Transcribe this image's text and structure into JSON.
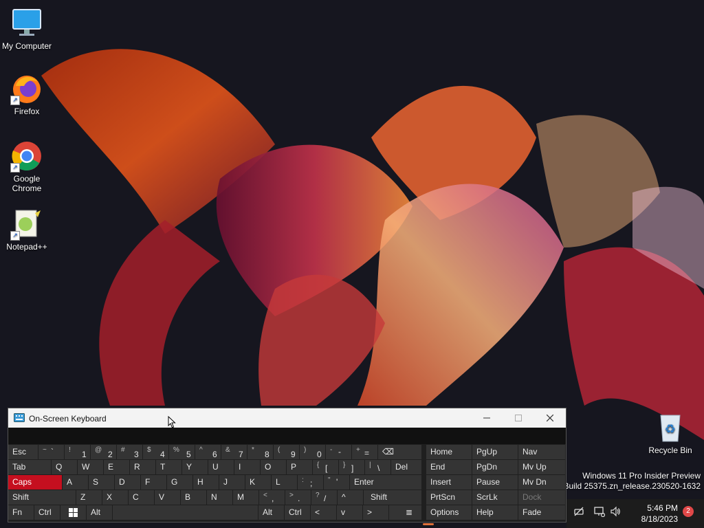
{
  "desktop": {
    "icons": [
      {
        "label": "My Computer",
        "icon": "monitor-icon"
      },
      {
        "label": "Firefox",
        "icon": "firefox-icon"
      },
      {
        "label": "Google Chrome",
        "icon": "chrome-icon"
      },
      {
        "label": "Notepad++",
        "icon": "notepad-icon"
      },
      {
        "label": "Recycle Bin",
        "icon": "recycle-bin-icon"
      }
    ],
    "watermark": {
      "line1": "Windows 11 Pro Insider Preview",
      "line2": "y. Build 25375.zn_release.230520-1632"
    }
  },
  "osk": {
    "title": "On-Screen Keyboard",
    "colors": {
      "caps_active": "#c50f1f",
      "key_bg": "#343434",
      "title_bg": "#f3f3f3"
    },
    "row1": [
      {
        "top": "~",
        "main": "`"
      },
      {
        "top": "!",
        "main": "1"
      },
      {
        "top": "@",
        "main": "2"
      },
      {
        "top": "#",
        "main": "3"
      },
      {
        "top": "$",
        "main": "4"
      },
      {
        "top": "%",
        "main": "5"
      },
      {
        "top": "^",
        "main": "6"
      },
      {
        "top": "&",
        "main": "7"
      },
      {
        "top": "*",
        "main": "8"
      },
      {
        "top": "(",
        "main": "9"
      },
      {
        "top": ")",
        "main": "0"
      },
      {
        "top": "-",
        "main": "-"
      },
      {
        "top": "+",
        "main": "="
      }
    ],
    "esc": "Esc",
    "backspace_icon": "⌫",
    "tab": "Tab",
    "row2": [
      "Q",
      "W",
      "E",
      "R",
      "T",
      "Y",
      "U",
      "I",
      "O",
      "P"
    ],
    "row2_brackets": [
      {
        "top": "{",
        "main": "["
      },
      {
        "top": "}",
        "main": "]"
      },
      {
        "top": "|",
        "main": "\\"
      }
    ],
    "del": "Del",
    "caps": "Caps",
    "row3": [
      "A",
      "S",
      "D",
      "F",
      "G",
      "H",
      "J",
      "K",
      "L"
    ],
    "row3_punct": [
      {
        "top": ":",
        "main": ";"
      },
      {
        "top": "\"",
        "main": "'"
      }
    ],
    "enter": "Enter",
    "shift": "Shift",
    "row4": [
      "Z",
      "X",
      "C",
      "V",
      "B",
      "N",
      "M"
    ],
    "row4_punct": [
      {
        "top": "<",
        "main": ","
      },
      {
        "top": ">",
        "main": "."
      },
      {
        "top": "?",
        "main": "/"
      }
    ],
    "up": "^",
    "shift_right": "Shift",
    "fn": "Fn",
    "ctrl": "Ctrl",
    "alt": "Alt",
    "alt_right": "Alt",
    "ctrl_right": "Ctrl",
    "left": "<",
    "down": "v",
    "right": ">",
    "menu_icon": "≣",
    "nav": {
      "col1": [
        "Home",
        "End",
        "Insert",
        "PrtScn",
        "Options"
      ],
      "col2": [
        "PgUp",
        "PgDn",
        "Pause",
        "ScrLk",
        "Help"
      ],
      "col3": [
        "Nav",
        "Mv Up",
        "Mv Dn",
        "Dock",
        "Fade"
      ]
    }
  },
  "tray": {
    "time": "5:46 PM",
    "date": "8/18/2023",
    "notifications": "2"
  }
}
